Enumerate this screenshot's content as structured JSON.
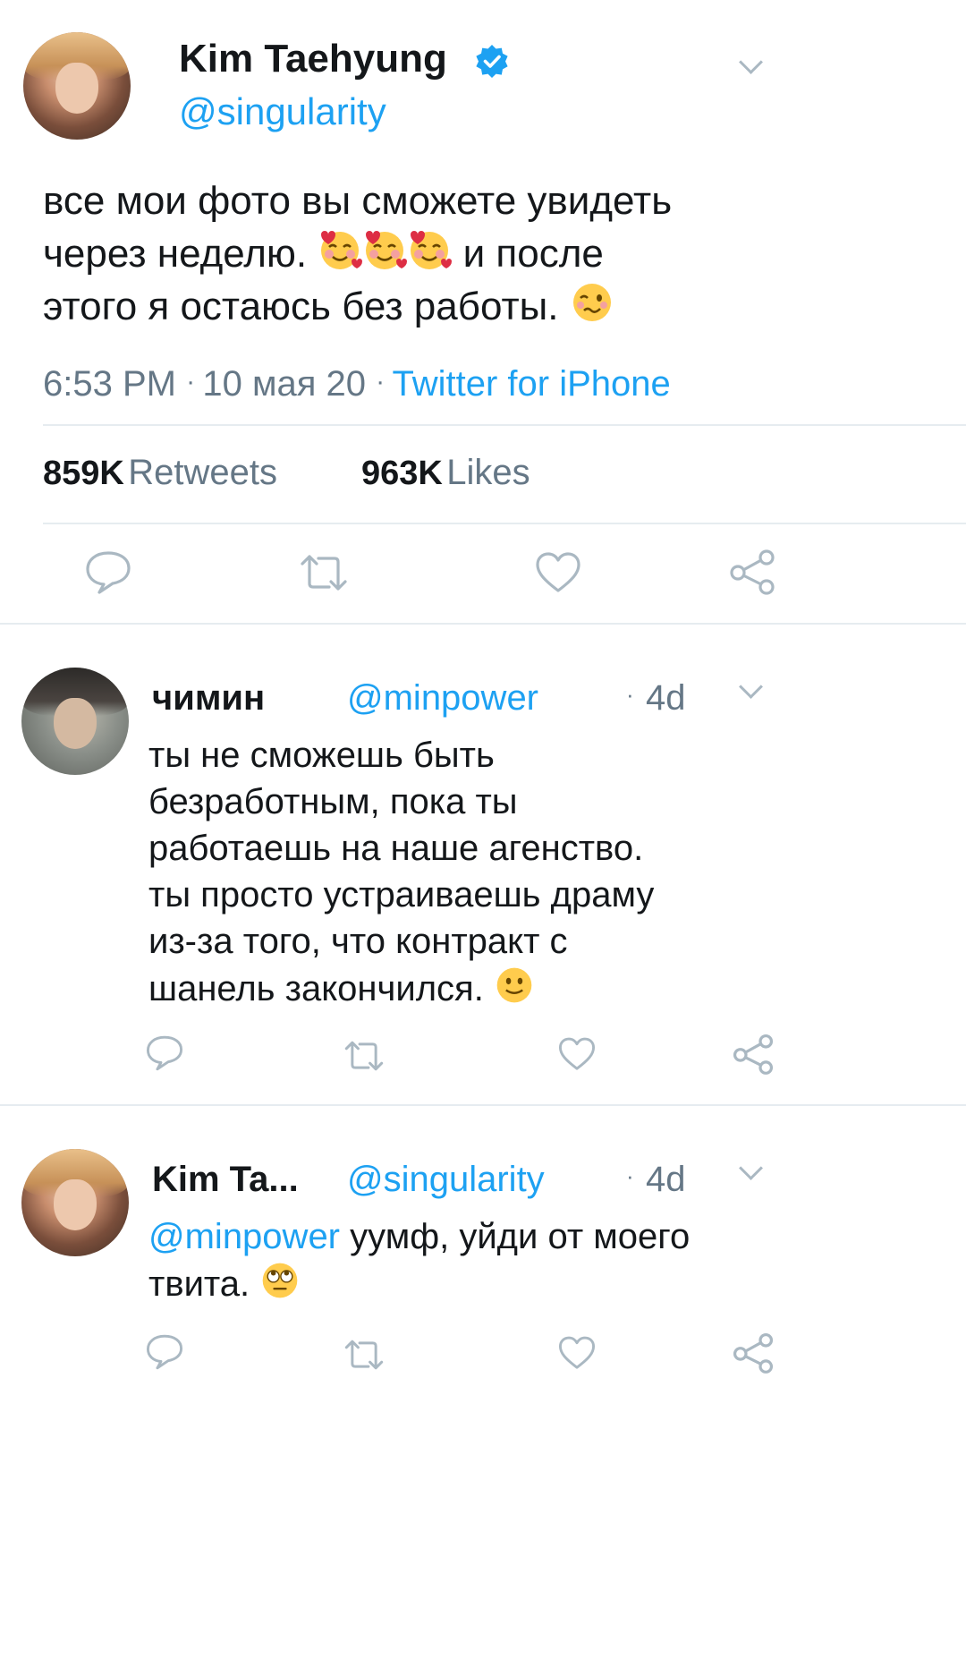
{
  "main_tweet": {
    "author_name": "Kim Taehyung",
    "handle": "@singularity",
    "text_line1": "все мои фото вы сможете увидеть",
    "text_line2_a": "через неделю.",
    "text_line2_b": "и после",
    "text_line3": "этого я остаюсь без работы.",
    "time": "6:53 PM",
    "date": "10 мая 20",
    "source": "Twitter for iPhone",
    "retweets_count": "859K",
    "retweets_label": "Retweets",
    "likes_count": "963K",
    "likes_label": "Likes"
  },
  "replies": [
    {
      "author_name": "чимин",
      "handle": "@minpower",
      "age": "4d",
      "lines": [
        "ты не сможешь быть",
        "безработным, пока ты",
        "работаешь на наше агенство.",
        "ты просто устраиваешь драму",
        "из-за того, что контракт с",
        "шанель закончился."
      ]
    },
    {
      "author_name": "Kim Ta...",
      "handle": "@singularity",
      "age": "4d",
      "mention": "@minpower",
      "line1_rest": "уумф, уйди от моего",
      "line2": "твита."
    }
  ],
  "colors": {
    "accent": "#1da1f2",
    "muted": "#657786",
    "icon": "#aab8c2",
    "divider": "#e6ecf0"
  },
  "icons": [
    "verified-badge-icon",
    "chevron-down-icon",
    "reply-icon",
    "retweet-icon",
    "like-icon",
    "share-icon"
  ]
}
